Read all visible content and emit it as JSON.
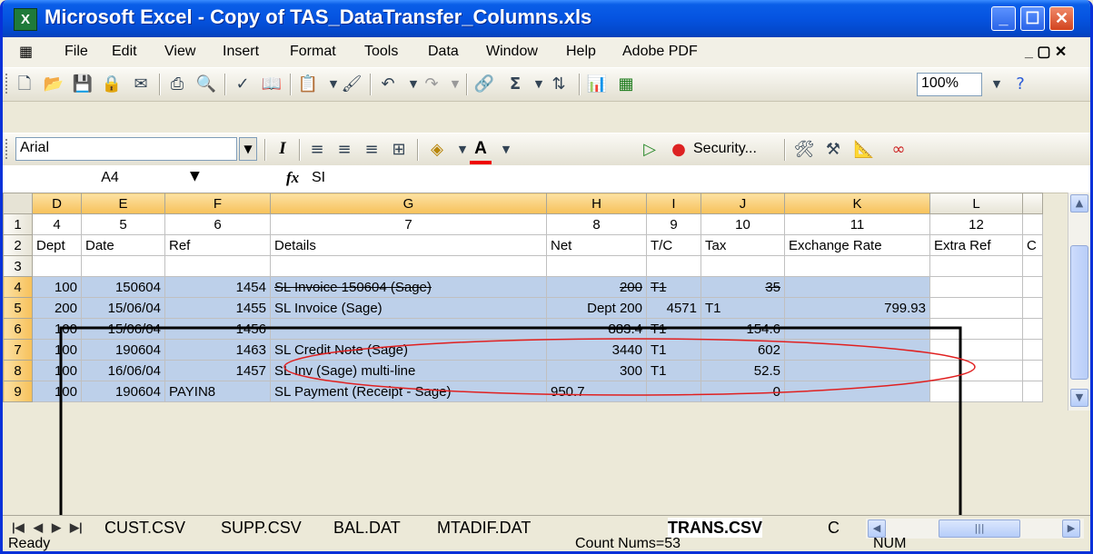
{
  "window": {
    "title": "Microsoft Excel - Copy of TAS_DataTransfer_Columns.xls",
    "app_icon": "excel-icon"
  },
  "menu": [
    "File",
    "Edit",
    "View",
    "Insert",
    "Format",
    "Tools",
    "Data",
    "Window",
    "Help",
    "Adobe PDF"
  ],
  "toolbar": {
    "zoom": "100%",
    "security_label": "Security..."
  },
  "format_toolbar": {
    "font": "Arial"
  },
  "formula_bar": {
    "cell_ref": "A4",
    "fx": "fx",
    "content": "SI"
  },
  "columns": [
    "D",
    "E",
    "F",
    "G",
    "H",
    "I",
    "J",
    "K",
    "L"
  ],
  "rows": [
    {
      "num": "1",
      "cells": [
        "4",
        "5",
        "6",
        "7",
        "8",
        "9",
        "10",
        "11",
        "12"
      ]
    },
    {
      "num": "2",
      "cells": [
        "Dept",
        "Date",
        "Ref",
        "Details",
        "Net",
        "T/C",
        "Tax",
        "Exchange Rate",
        "Extra Ref"
      ],
      "overflow": "C"
    },
    {
      "num": "3",
      "cells": [
        "",
        "",
        "",
        "",
        "",
        "",
        "",
        "",
        ""
      ]
    },
    {
      "num": "4",
      "cells": [
        "100",
        "150604",
        "1454",
        "SL Invoice 150604 (Sage)",
        "200",
        "T1",
        "35",
        "",
        ""
      ]
    },
    {
      "num": "5",
      "cells": [
        "200",
        "15/06/04",
        "1455",
        "SL Invoice (Sage)",
        "Dept 200",
        "4571",
        "T1",
        "799.93",
        ""
      ]
    },
    {
      "num": "6",
      "cells": [
        "100",
        "15/06/04",
        "1456",
        "",
        "883.4",
        "T1",
        "154.6",
        "",
        ""
      ]
    },
    {
      "num": "7",
      "cells": [
        "100",
        "190604",
        "1463",
        "SL Credit Note (Sage)",
        "3440",
        "T1",
        "602",
        "",
        ""
      ]
    },
    {
      "num": "8",
      "cells": [
        "100",
        "16/06/04",
        "1457",
        "SL Inv (Sage) multi-line",
        "300",
        "T1",
        "52.5",
        "",
        ""
      ]
    },
    {
      "num": "9",
      "cells": [
        "100",
        "190604",
        "PAYIN8",
        "SL Payment (Receipt - Sage)",
        "950.7",
        "",
        "0",
        "",
        ""
      ]
    }
  ],
  "sheet_tabs": [
    "CUST.CSV",
    "SUPP.CSV",
    "BAL.DAT",
    "MTADIF.DAT",
    "TRANS.CSV",
    "C"
  ],
  "active_tab": "TRANS.CSV",
  "status": {
    "ready": "Ready",
    "sum": "Count Nums=53",
    "num": "NUM"
  },
  "colors": {
    "title_bar": "#0553e0",
    "selection": "#bdd0ea",
    "header_highlight": "#f7c15a",
    "annotation": "#e02020"
  }
}
